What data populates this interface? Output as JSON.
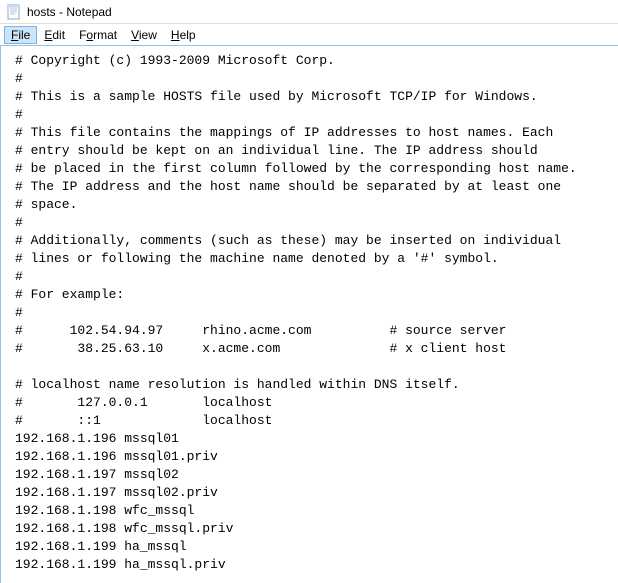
{
  "titlebar": {
    "title": "hosts - Notepad"
  },
  "menubar": {
    "items": [
      {
        "label": "File",
        "accel_index": 0,
        "active": true
      },
      {
        "label": "Edit",
        "accel_index": 0,
        "active": false
      },
      {
        "label": "Format",
        "accel_index": 1,
        "active": false
      },
      {
        "label": "View",
        "accel_index": 0,
        "active": false
      },
      {
        "label": "Help",
        "accel_index": 0,
        "active": false
      }
    ]
  },
  "editor": {
    "content": "# Copyright (c) 1993-2009 Microsoft Corp.\n#\n# This is a sample HOSTS file used by Microsoft TCP/IP for Windows.\n#\n# This file contains the mappings of IP addresses to host names. Each\n# entry should be kept on an individual line. The IP address should\n# be placed in the first column followed by the corresponding host name.\n# The IP address and the host name should be separated by at least one\n# space.\n#\n# Additionally, comments (such as these) may be inserted on individual\n# lines or following the machine name denoted by a '#' symbol.\n#\n# For example:\n#\n#      102.54.94.97     rhino.acme.com          # source server\n#       38.25.63.10     x.acme.com              # x client host\n\n# localhost name resolution is handled within DNS itself.\n#       127.0.0.1       localhost\n#       ::1             localhost\n192.168.1.196 mssql01\n192.168.1.196 mssql01.priv\n192.168.1.197 mssql02\n192.168.1.197 mssql02.priv\n192.168.1.198 wfc_mssql\n192.168.1.198 wfc_mssql.priv\n192.168.1.199 ha_mssql\n192.168.1.199 ha_mssql.priv"
  }
}
